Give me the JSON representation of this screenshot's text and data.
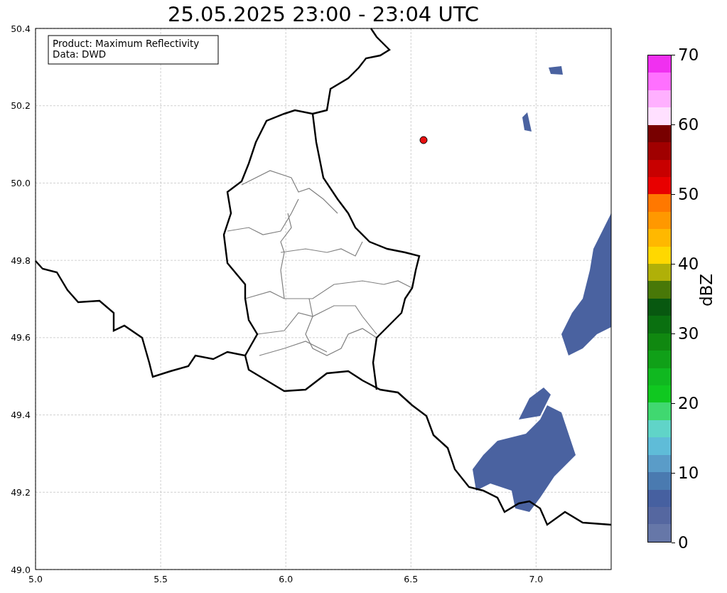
{
  "map": {
    "title": "25.05.2025 23:00 - 23:04 UTC",
    "x_ticks": [
      "5.0",
      "5.5",
      "6.0",
      "6.5",
      "7.0"
    ],
    "y_ticks": [
      "50.4",
      "50.2",
      "50.0",
      "49.8",
      "49.6",
      "49.4",
      "49.2",
      "49.0"
    ],
    "legend": [
      "Product: Maximum Reflectivity",
      "Data: DWD"
    ]
  },
  "colorbar": {
    "label": "dBZ",
    "ticks": [
      "70",
      "60",
      "50",
      "40",
      "30",
      "20",
      "10",
      "0"
    ],
    "segments": [
      {
        "color": "#f030f0"
      },
      {
        "color": "#ff70ff"
      },
      {
        "color": "#ffb0ff"
      },
      {
        "color": "#ffe0ff"
      },
      {
        "color": "#780000"
      },
      {
        "color": "#a00000"
      },
      {
        "color": "#c80000"
      },
      {
        "color": "#e80000"
      },
      {
        "color": "#ff7800"
      },
      {
        "color": "#ff9800"
      },
      {
        "color": "#ffb800"
      },
      {
        "color": "#ffd800"
      },
      {
        "color": "#b0b008"
      },
      {
        "color": "#487808"
      },
      {
        "color": "#085810"
      },
      {
        "color": "#0a7010"
      },
      {
        "color": "#108810"
      },
      {
        "color": "#10a018"
      },
      {
        "color": "#10b820"
      },
      {
        "color": "#10c820"
      },
      {
        "color": "#40d870"
      },
      {
        "color": "#60d4c8"
      },
      {
        "color": "#5fbcd8"
      },
      {
        "color": "#5a9cc8"
      },
      {
        "color": "#4a7ab0"
      },
      {
        "color": "#4660a0"
      },
      {
        "color": "#5567a0"
      },
      {
        "color": "#6677a8"
      }
    ]
  }
}
